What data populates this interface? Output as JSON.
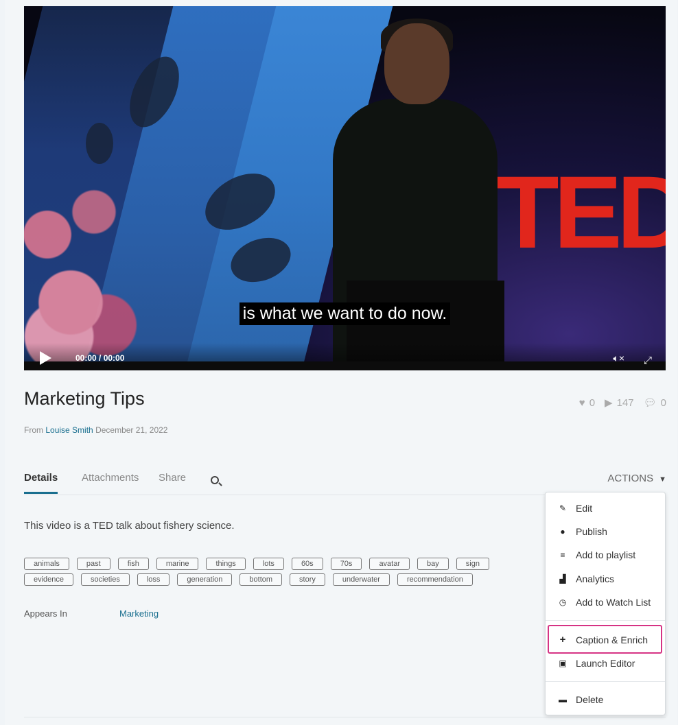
{
  "video": {
    "caption": "is what we want to do now.",
    "time": "00:00 / 00:00",
    "logo_text": "TED"
  },
  "entry": {
    "title": "Marketing Tips",
    "from_label": "From",
    "author": "Louise Smith",
    "date": "December 21, 2022",
    "likes": "0",
    "plays": "147",
    "comments": "0"
  },
  "tabs": [
    {
      "label": "Details",
      "active": true
    },
    {
      "label": "Attachments",
      "active": false
    },
    {
      "label": "Share",
      "active": false
    }
  ],
  "actions_label": "ACTIONS",
  "description": "This video is a TED talk about fishery science.",
  "tags_row1": [
    "animals",
    "past",
    "fish",
    "marine",
    "things",
    "lots",
    "60s",
    "70s",
    "avatar",
    "bay",
    "sign"
  ],
  "tags_row2": [
    "evidence",
    "societies",
    "loss",
    "generation",
    "bottom",
    "story",
    "underwater",
    "recommendation"
  ],
  "appears_in": {
    "label": "Appears In",
    "value": "Marketing"
  },
  "menu": {
    "items": [
      {
        "label": "Edit",
        "icon": "pencil-icon"
      },
      {
        "label": "Publish",
        "icon": "globe-icon"
      },
      {
        "label": "Add to playlist",
        "icon": "playlist-add-icon"
      },
      {
        "label": "Analytics",
        "icon": "bar-chart-icon"
      },
      {
        "label": "Add to Watch List",
        "icon": "clock-icon"
      },
      {
        "label": "Caption & Enrich",
        "icon": "plus-icon"
      },
      {
        "label": "Launch Editor",
        "icon": "clapperboard-icon"
      },
      {
        "label": "Delete",
        "icon": "trash-icon"
      }
    ]
  },
  "colors": {
    "accent": "#1a6f8f",
    "highlight": "#d63384",
    "ted_red": "#e1261c"
  }
}
